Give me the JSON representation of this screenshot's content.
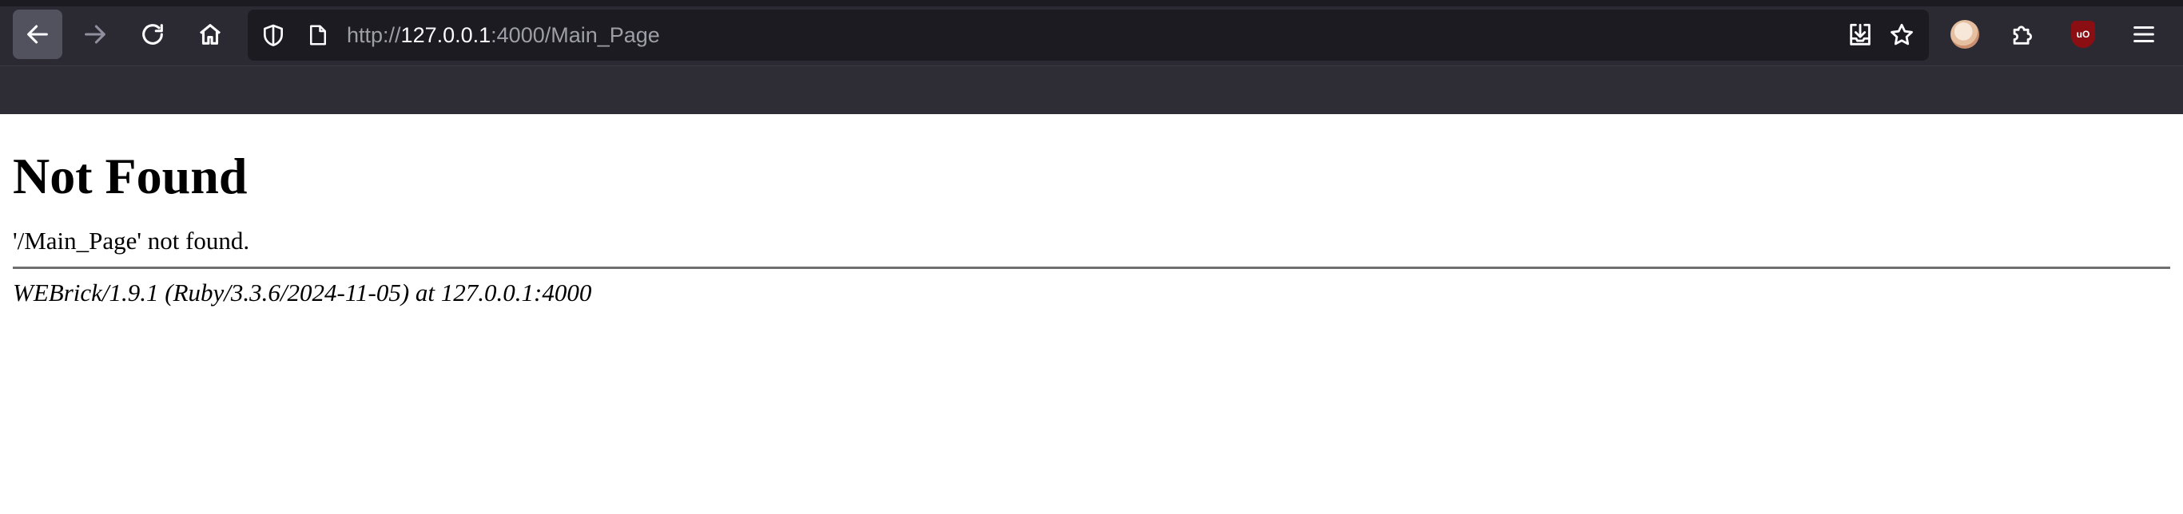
{
  "browser": {
    "url": {
      "scheme": "http://",
      "host": "127.0.0.1",
      "rest": ":4000/Main_Page"
    },
    "icons": {
      "back": "arrow-left-icon",
      "forward": "arrow-right-icon",
      "reload": "reload-icon",
      "home": "home-icon",
      "tracking_protection": "shield-icon",
      "page_info": "page-icon",
      "save_to_pocket": "download-tray-icon",
      "bookmark": "star-icon",
      "account": "avatar-icon",
      "extensions": "puzzle-icon",
      "ublock": "ublock-origin-icon",
      "menu": "hamburger-menu-icon"
    },
    "ublock_label": "uO",
    "colors": {
      "toolbar": "#2b2a33",
      "urlbar": "#1c1b22",
      "icon": "#fbfbfe",
      "icon_disabled": "#8f8f9d",
      "ublock": "#8b0f12"
    }
  },
  "page": {
    "heading": "Not Found",
    "message": "'/Main_Page' not found.",
    "server_signature": "WEBrick/1.9.1 (Ruby/3.3.6/2024-11-05) at 127.0.0.1:4000"
  }
}
